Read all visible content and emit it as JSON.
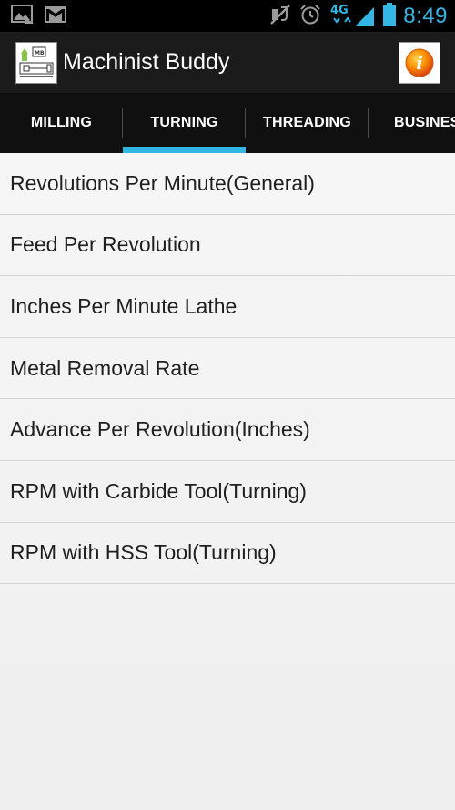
{
  "status_bar": {
    "time": "8:49",
    "network": "4G",
    "icons": [
      "picture-icon",
      "gmail-icon",
      "mute-icon",
      "alarm-icon",
      "signal-icon",
      "battery-icon"
    ]
  },
  "action_bar": {
    "title": "Machinist Buddy",
    "logo_text": "MB",
    "info_icon": "i"
  },
  "tabs": [
    {
      "label": "MILLING",
      "selected": false
    },
    {
      "label": "TURNING",
      "selected": true
    },
    {
      "label": "THREADING",
      "selected": false
    },
    {
      "label": "BUSINES",
      "selected": false
    }
  ],
  "list": {
    "items": [
      "Revolutions Per Minute(General)",
      "Feed Per Revolution",
      "Inches Per Minute Lathe",
      "Metal Removal Rate",
      "Advance Per Revolution(Inches)",
      "RPM with Carbide Tool(Turning)",
      "RPM with HSS Tool(Turning)"
    ]
  },
  "colors": {
    "accent": "#33b5e5",
    "status_bar": "#000000",
    "action_bar": "#1b1b1b",
    "tab_bar": "#101010",
    "info_icon": "#f57f17"
  }
}
